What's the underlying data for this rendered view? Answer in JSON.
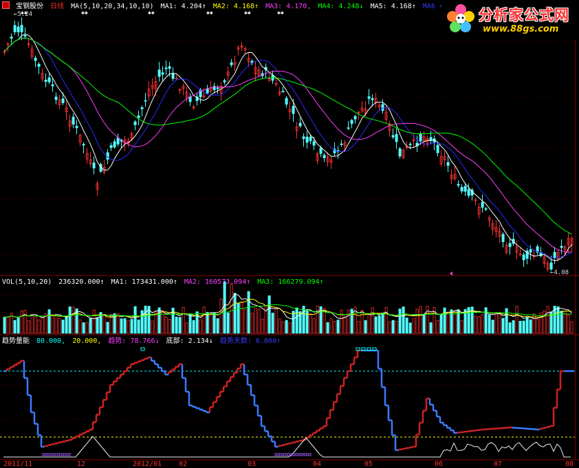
{
  "header": {
    "icon": "red-square-icon",
    "stock_name": "宝钢股份",
    "period": "日线",
    "ma_params": "MA(5,10,20,34,10,10)",
    "ma1": "MA1: 4.204↑",
    "ma2": "MA2: 4.168↑",
    "ma3": "MA3: 4.170,",
    "ma4": "MA4: 4.248↓",
    "ma5": "MA5: 4.168↑",
    "ma6": "MA6  4."
  },
  "vol_header": {
    "params": "VOL(5,10,20)",
    "value": "236320.000↑",
    "ma1": "MA1: 173431.000↑",
    "ma2": "MA2: 160573.094↑",
    "ma3": "MA3: 166279.094↑"
  },
  "ind_header": {
    "name": "趋势量能",
    "v80": "80.000,",
    "v20": "20.000,",
    "trend": "趋势: 78.766↓",
    "bottom": "底部: 2.134↓",
    "days": "趋势天数: 6.000↑"
  },
  "price_marks": {
    "high": "5.24",
    "low": "4.08"
  },
  "x_labels": [
    "2011/11",
    "12",
    "2012/01",
    "02",
    "03",
    "04",
    "05",
    "06",
    "07",
    "08"
  ],
  "logo": {
    "title": "分析家公式网",
    "url": "www.88gs.com"
  },
  "colors": {
    "up": "#ff3333",
    "down": "#54ffff",
    "ma1": "#ffffff",
    "ma2": "#ffff00",
    "ma3": "#ff40ff",
    "ma4": "#00ff00",
    "ma5": "#2a2aff",
    "grid": "#8b0000",
    "trend_up": "#cc2222",
    "trend_down": "#3b7bff"
  }
}
